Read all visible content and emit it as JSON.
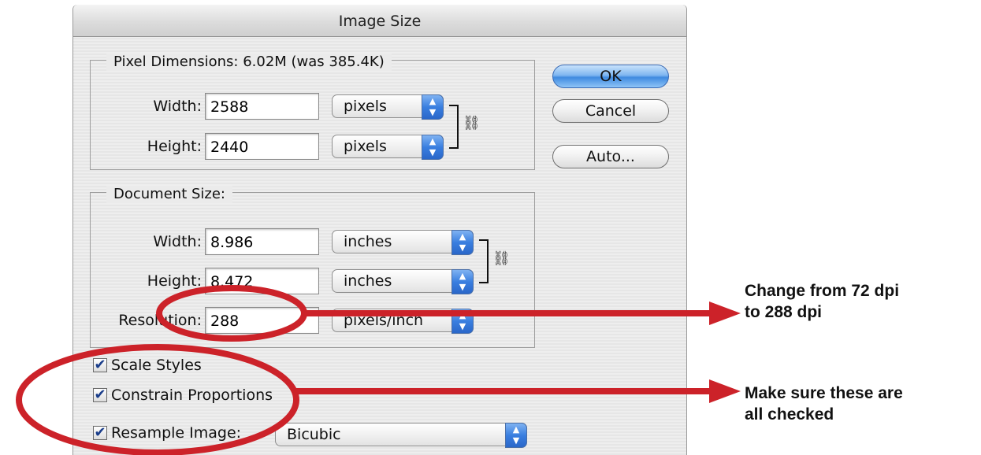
{
  "dialog": {
    "title": "Image Size",
    "pixel_dimensions": {
      "legend": "Pixel Dimensions:  6.02M (was 385.4K)",
      "width_label": "Width:",
      "width_value": "2588",
      "width_unit": "pixels",
      "height_label": "Height:",
      "height_value": "2440",
      "height_unit": "pixels"
    },
    "document_size": {
      "legend": "Document Size:",
      "width_label": "Width:",
      "width_value": "8.986",
      "width_unit": "inches",
      "height_label": "Height:",
      "height_value": "8.472",
      "height_unit": "inches",
      "resolution_label": "Resolution:",
      "resolution_value": "288",
      "resolution_unit": "pixels/inch"
    },
    "buttons": {
      "ok": "OK",
      "cancel": "Cancel",
      "auto": "Auto..."
    },
    "options": {
      "scale_styles": "Scale Styles",
      "constrain_proportions": "Constrain Proportions",
      "resample_image": "Resample Image:",
      "resample_method": "Bicubic"
    }
  },
  "annotations": {
    "note1_line1": "Change from 72 dpi",
    "note1_line2": "to 288 dpi",
    "note2_line1": "Make sure these are",
    "note2_line2": "all checked",
    "color": "#cc2229"
  },
  "icons": {
    "checkmark": "✔",
    "stepper_up": "▲",
    "stepper_down": "▼",
    "chain_link": "link-icon"
  }
}
